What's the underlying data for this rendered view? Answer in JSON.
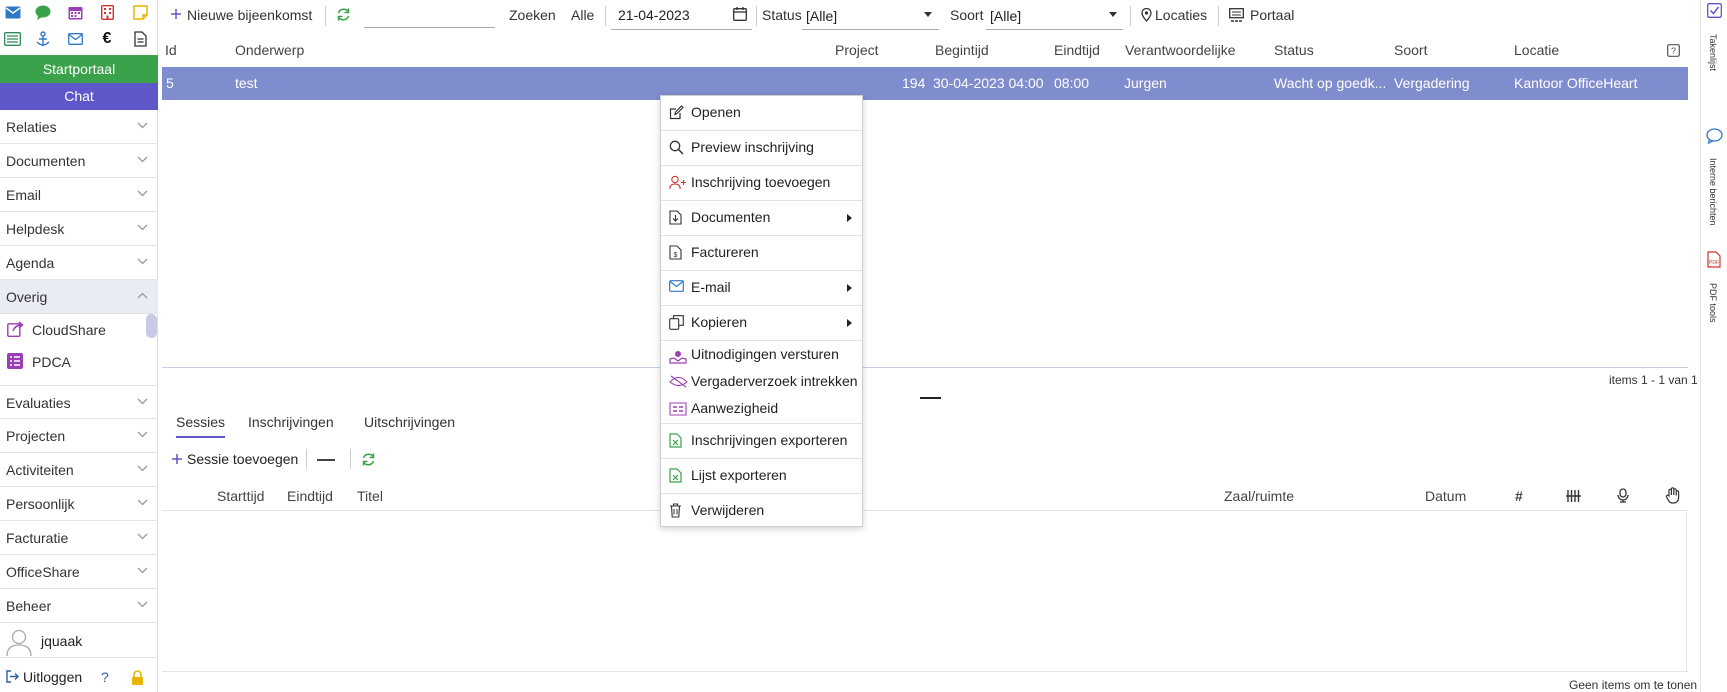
{
  "sidebar": {
    "top_icons": [
      "mail-icon",
      "chat-icon",
      "calendar-icon",
      "building-icon",
      "note-icon",
      "list-icon",
      "anchor-icon",
      "envelope-icon",
      "euro-icon",
      "document-icon"
    ],
    "startportaal": "Startportaal",
    "chat": "Chat",
    "items": [
      "Relaties",
      "Documenten",
      "Email",
      "Helpdesk",
      "Agenda",
      "Overig"
    ],
    "sub_items": [
      "CloudShare",
      "PDCA"
    ],
    "items2": [
      "Evaluaties",
      "Projecten",
      "Activiteiten",
      "Persoonlijk",
      "Facturatie",
      "OfficeShare",
      "Beheer"
    ],
    "user": "jquaak",
    "logout": "Uitloggen",
    "help": "?"
  },
  "toolbar": {
    "new_meeting": "Nieuwe bijeenkomst",
    "search_value": "",
    "zoeken": "Zoeken",
    "alle": "Alle",
    "date": "21-04-2023",
    "status_label": "Status",
    "status_value": "[Alle]",
    "soort_label": "Soort",
    "soort_value": "[Alle]",
    "locaties": "Locaties",
    "portaal": "Portaal"
  },
  "grid": {
    "headers": [
      "Id",
      "Onderwerp",
      "Project",
      "Begintijd",
      "Eindtijd",
      "Verantwoordelijke",
      "Status",
      "Soort",
      "Locatie"
    ],
    "row": {
      "id": "5",
      "onderwerp": "test",
      "project": "194",
      "begintijd": "30-04-2023 04:00",
      "eindtijd": "08:00",
      "verantwoordelijke": "Jurgen",
      "status": "Wacht op goedk...",
      "soort": "Vergadering",
      "locatie": "Kantoor OfficeHeart"
    },
    "pager": "items 1 - 1 van 1"
  },
  "context_menu": {
    "items": [
      "Openen",
      "Preview inschrijving",
      "Inschrijving toevoegen",
      "Documenten",
      "Factureren",
      "E-mail",
      "Kopieren",
      "Uitnodigingen versturen",
      "Vergaderverzoek intrekken",
      "Aanwezigheid",
      "Inschrijvingen exporteren",
      "Lijst exporteren",
      "Verwijderen"
    ]
  },
  "lower": {
    "tabs": [
      "Sessies",
      "Inschrijvingen",
      "Uitschrijvingen"
    ],
    "add_session": "Sessie toevoegen",
    "headers": [
      "Starttijd",
      "Eindtijd",
      "Titel",
      "Zaal/ruimte",
      "Datum",
      "#"
    ],
    "empty": "Geen items om te tonen"
  },
  "rail": {
    "labels": [
      "Takenlijst",
      "Interne berichten",
      "PDF tools"
    ]
  },
  "colors": {
    "accent": "#5e57c9",
    "green": "#3aa24a",
    "selected_row": "#7f8ccd"
  }
}
